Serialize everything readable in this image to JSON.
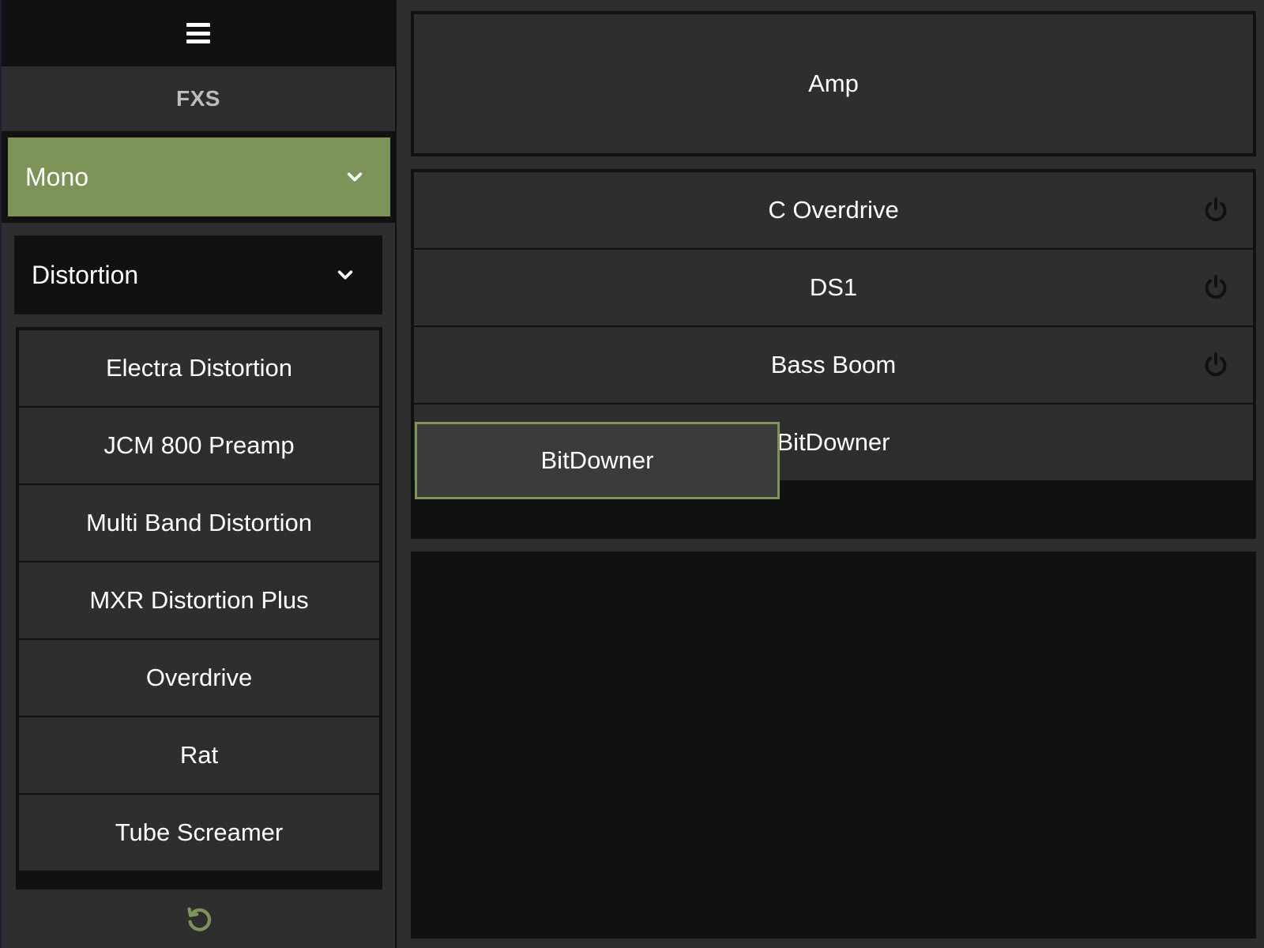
{
  "sidebar": {
    "header": "FXS",
    "mono_select": "Mono",
    "category_select": "Distortion",
    "effects": [
      "Electra Distortion",
      "JCM 800 Preamp",
      "Multi Band Distortion",
      "MXR Distortion Plus",
      "Overdrive",
      "Rat",
      "Tube Screamer"
    ]
  },
  "main": {
    "amp_label": "Amp",
    "chain": [
      {
        "label": "C Overdrive"
      },
      {
        "label": "DS1"
      },
      {
        "label": "Bass Boom"
      },
      {
        "label": "BitDowner"
      }
    ],
    "dragging_label": "BitDowner"
  },
  "icons": {
    "menu": "hamburger-menu-icon",
    "chevron": "chevron-down-icon",
    "power": "power-icon",
    "undo": "undo-icon"
  },
  "colors": {
    "accent": "#7d9459",
    "panel": "#2e2e2e",
    "dark": "#111111"
  }
}
